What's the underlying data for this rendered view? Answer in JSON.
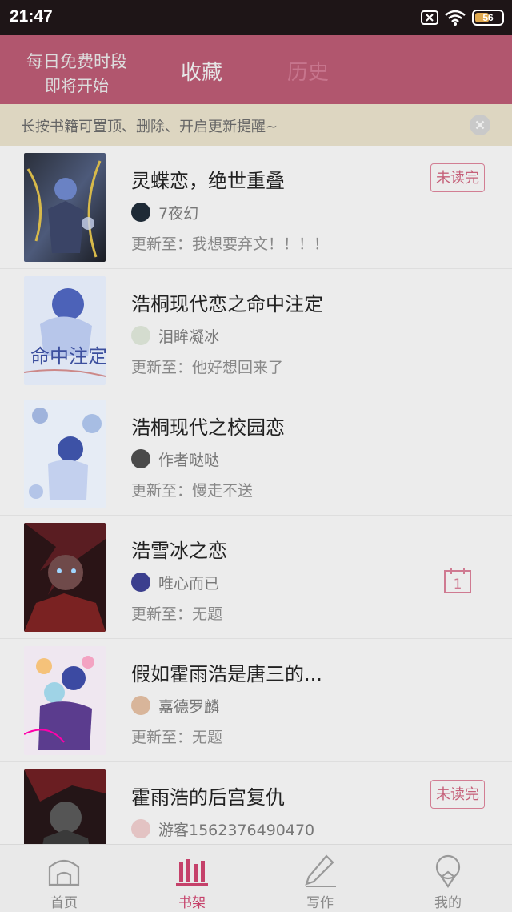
{
  "status_bar": {
    "time": "21:47",
    "battery": "56",
    "icons": [
      "sim-blocked-icon",
      "wifi-icon",
      "battery-icon"
    ]
  },
  "top_nav": {
    "free_slot_line1": "每日免费时段",
    "free_slot_line2": "即将开始",
    "tabs": [
      {
        "label": "收藏",
        "active": true
      },
      {
        "label": "历史",
        "active": false
      }
    ]
  },
  "notice": {
    "text": "长按书籍可置顶、删除、开启更新提醒~"
  },
  "books": [
    {
      "title": "灵蝶恋，绝世重叠",
      "author": "7夜幻",
      "update": "更新至：我想要弃文！！！！",
      "badge": "未读完"
    },
    {
      "title": "浩桐现代恋之命中注定",
      "author": "泪眸凝冰",
      "update": "更新至：他好想回来了",
      "badge": ""
    },
    {
      "title": "浩桐现代之校园恋",
      "author": "作者哒哒",
      "update": "更新至：慢走不送",
      "badge": ""
    },
    {
      "title": "浩雪冰之恋",
      "author": "唯心而已",
      "update": "更新至：无题",
      "badge": "",
      "calendar_day": "1"
    },
    {
      "title": "假如霍雨浩是唐三的...",
      "author": "嘉德罗麟",
      "update": "更新至：无题",
      "badge": ""
    },
    {
      "title": "霍雨浩的后宫复仇",
      "author": "游客1562376490470",
      "update": "",
      "badge": "未读完"
    }
  ],
  "tab_bar": [
    {
      "label": "首页",
      "icon": "home-icon",
      "active": false
    },
    {
      "label": "书架",
      "icon": "bookshelf-icon",
      "active": true
    },
    {
      "label": "写作",
      "icon": "pencil-icon",
      "active": false
    },
    {
      "label": "我的",
      "icon": "profile-icon",
      "active": false
    }
  ],
  "colors": {
    "accent": "#c5416a",
    "nav_background": "#b1566e",
    "notice_background": "#ddd6c1"
  }
}
